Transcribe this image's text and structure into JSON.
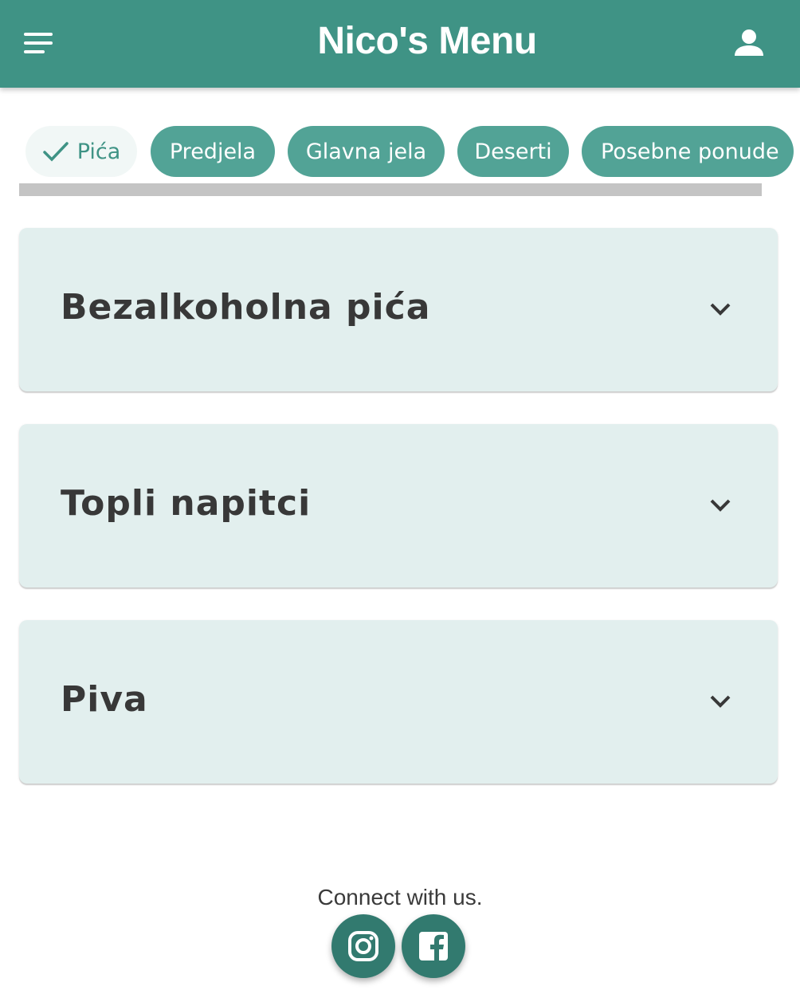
{
  "app_bar": {
    "title": "Nico's Menu",
    "menu_icon": "hamburger-menu-icon",
    "account_icon": "person-icon",
    "color": "#3f9385"
  },
  "categories": [
    {
      "label": "Pića",
      "selected": true
    },
    {
      "label": "Predjela",
      "selected": false
    },
    {
      "label": "Glavna jela",
      "selected": false
    },
    {
      "label": "Deserti",
      "selected": false
    },
    {
      "label": "Posebne ponude",
      "selected": false
    }
  ],
  "sections": [
    {
      "title": "Bezalkoholna pića",
      "expanded": false
    },
    {
      "title": "Topli napitci",
      "expanded": false
    },
    {
      "title": "Piva",
      "expanded": false
    }
  ],
  "footer": {
    "text": "Connect with us.",
    "social": [
      {
        "name": "instagram-icon"
      },
      {
        "name": "facebook-icon"
      }
    ]
  }
}
